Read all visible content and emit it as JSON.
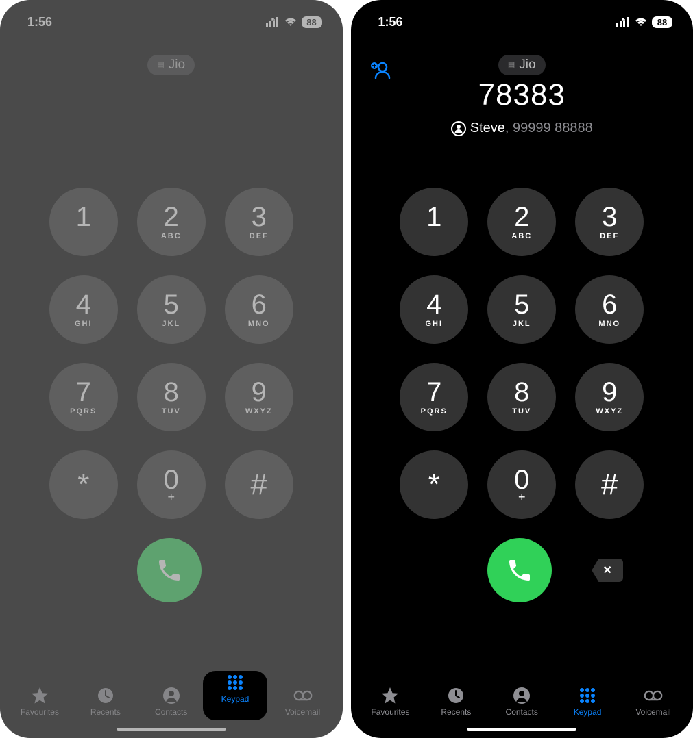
{
  "status": {
    "time": "1:56",
    "battery": "88"
  },
  "carrier": {
    "label": "Jio"
  },
  "dial": {
    "number": "78383",
    "suggestion_name": "Steve",
    "suggestion_sep": ", ",
    "suggestion_number": "99999 88888"
  },
  "keys": [
    {
      "digit": "1",
      "letters": ""
    },
    {
      "digit": "2",
      "letters": "ABC"
    },
    {
      "digit": "3",
      "letters": "DEF"
    },
    {
      "digit": "4",
      "letters": "GHI"
    },
    {
      "digit": "5",
      "letters": "JKL"
    },
    {
      "digit": "6",
      "letters": "MNO"
    },
    {
      "digit": "7",
      "letters": "PQRS"
    },
    {
      "digit": "8",
      "letters": "TUV"
    },
    {
      "digit": "9",
      "letters": "WXYZ"
    },
    {
      "digit": "*",
      "letters": "",
      "symbol": true
    },
    {
      "digit": "0",
      "letters": "+",
      "sub": true
    },
    {
      "digit": "#",
      "letters": "",
      "symbol": true
    }
  ],
  "tabs": [
    {
      "id": "favourites",
      "label": "Favourites"
    },
    {
      "id": "recents",
      "label": "Recents"
    },
    {
      "id": "contacts",
      "label": "Contacts"
    },
    {
      "id": "keypad",
      "label": "Keypad",
      "active": true
    },
    {
      "id": "voicemail",
      "label": "Voicemail"
    }
  ],
  "delete_glyph": "✕"
}
